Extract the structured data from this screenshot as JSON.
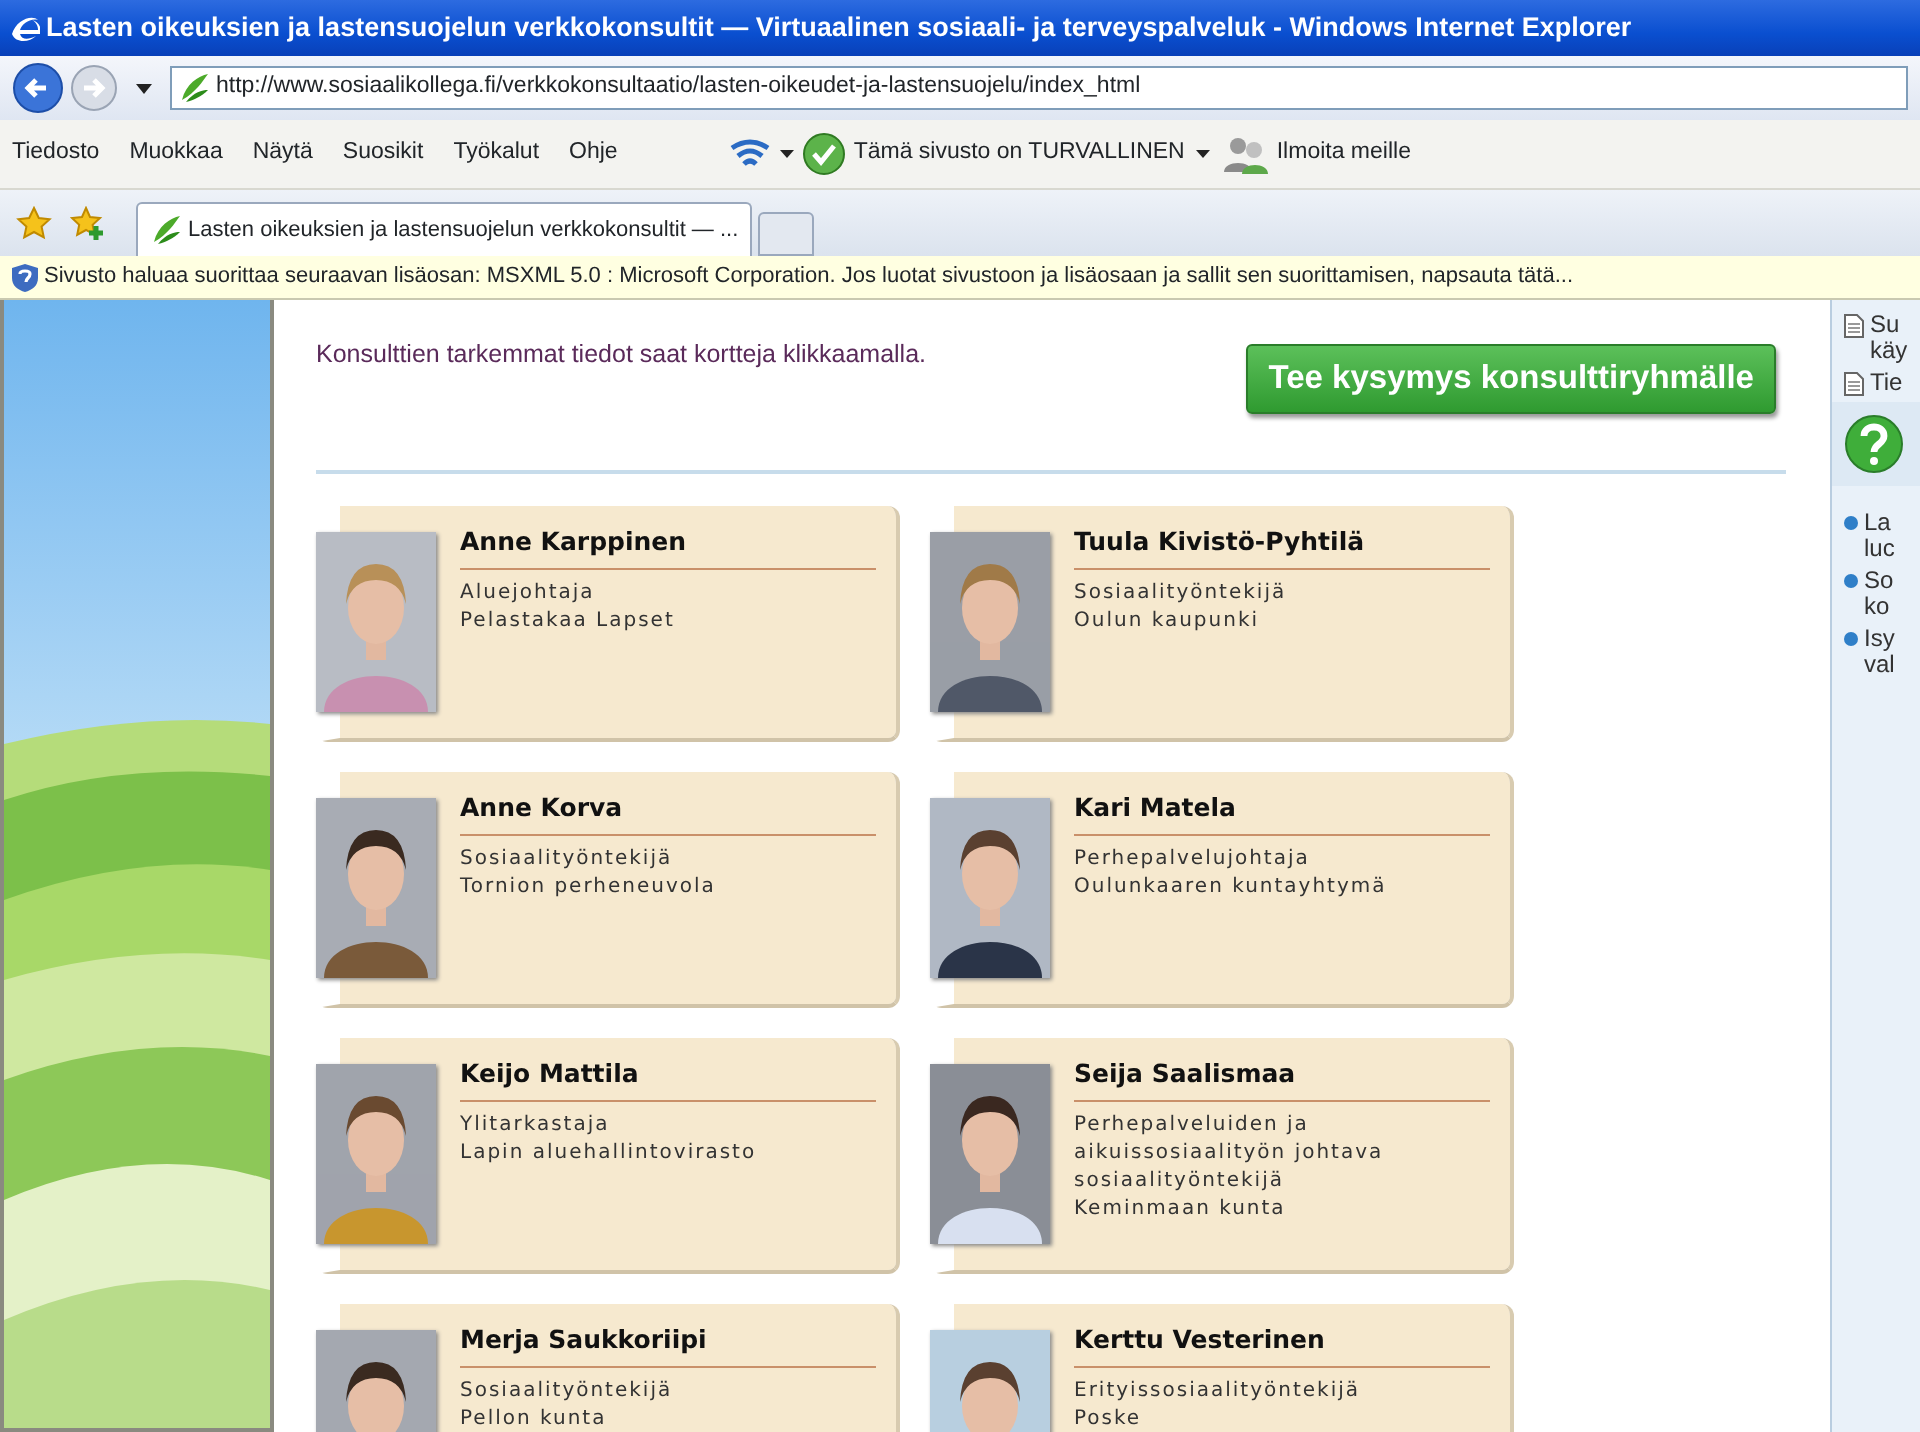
{
  "window": {
    "title": "Lasten oikeuksien ja lastensuojelun verkkokonsultit — Virtuaalinen sosiaali- ja terveyspalveluk - Windows Internet Explorer"
  },
  "address_bar": {
    "url": "http://www.sosiaalikollega.fi/verkkokonsultaatio/lasten-oikeudet-ja-lastensuojelu/index_html"
  },
  "menu": [
    "Tiedosto",
    "Muokkaa",
    "Näytä",
    "Suosikit",
    "Työkalut",
    "Ohje"
  ],
  "toolbar": {
    "safety": "Tämä sivusto on TURVALLINEN",
    "report": "Ilmoita meille"
  },
  "tabs": [
    {
      "label": "Lasten oikeuksien ja lastensuojelun verkkokonsultit — ...",
      "selected": true
    }
  ],
  "info_bar": {
    "text": "Sivusto haluaa suorittaa seuraavan lisäosan: MSXML 5.0 : Microsoft Corporation. Jos luotat sivustoon ja lisäosaan ja sallit sen suorittamisen, napsauta tätä..."
  },
  "page": {
    "intro": "Konsulttien tarkemmat tiedot saat kortteja klikkaamalla.",
    "ask_button": "Tee kysymys konsulttiryhmälle",
    "consultants": [
      {
        "name": "Anne Karppinen",
        "lines": [
          "Aluejohtaja",
          "Pelastakaa Lapset"
        ]
      },
      {
        "name": "Tuula Kivistö-Pyhtilä",
        "lines": [
          "Sosiaalityöntekijä",
          "Oulun kaupunki"
        ]
      },
      {
        "name": "Anne Korva",
        "lines": [
          "Sosiaalityöntekijä",
          "Tornion perheneuvola"
        ]
      },
      {
        "name": "Kari Matela",
        "lines": [
          "Perhepalvelujohtaja",
          "Oulunkaaren kuntayhtymä"
        ]
      },
      {
        "name": "Keijo Mattila",
        "lines": [
          "Ylitarkastaja",
          "Lapin aluehallintovirasto"
        ]
      },
      {
        "name": "Seija Saalismaa",
        "lines": [
          "Perhepalveluiden ja",
          "aikuissosiaalityön johtava",
          "sosiaalityöntekijä",
          "Keminmaan kunta"
        ]
      },
      {
        "name": "Merja Saukkoriipi",
        "lines": [
          "Sosiaalityöntekijä",
          "Pellon kunta"
        ]
      },
      {
        "name": "Kerttu Vesterinen",
        "lines": [
          "Erityissosiaalityöntekijä",
          "Poske"
        ]
      }
    ]
  },
  "right_sidebar": {
    "documents": [
      {
        "lines": [
          "Su",
          "käy"
        ]
      },
      {
        "lines": [
          "Tie"
        ]
      }
    ],
    "links": [
      {
        "lines": [
          "La",
          "luc"
        ]
      },
      {
        "lines": [
          "So",
          "ko"
        ]
      },
      {
        "lines": [
          "Isy",
          "val"
        ]
      }
    ]
  }
}
